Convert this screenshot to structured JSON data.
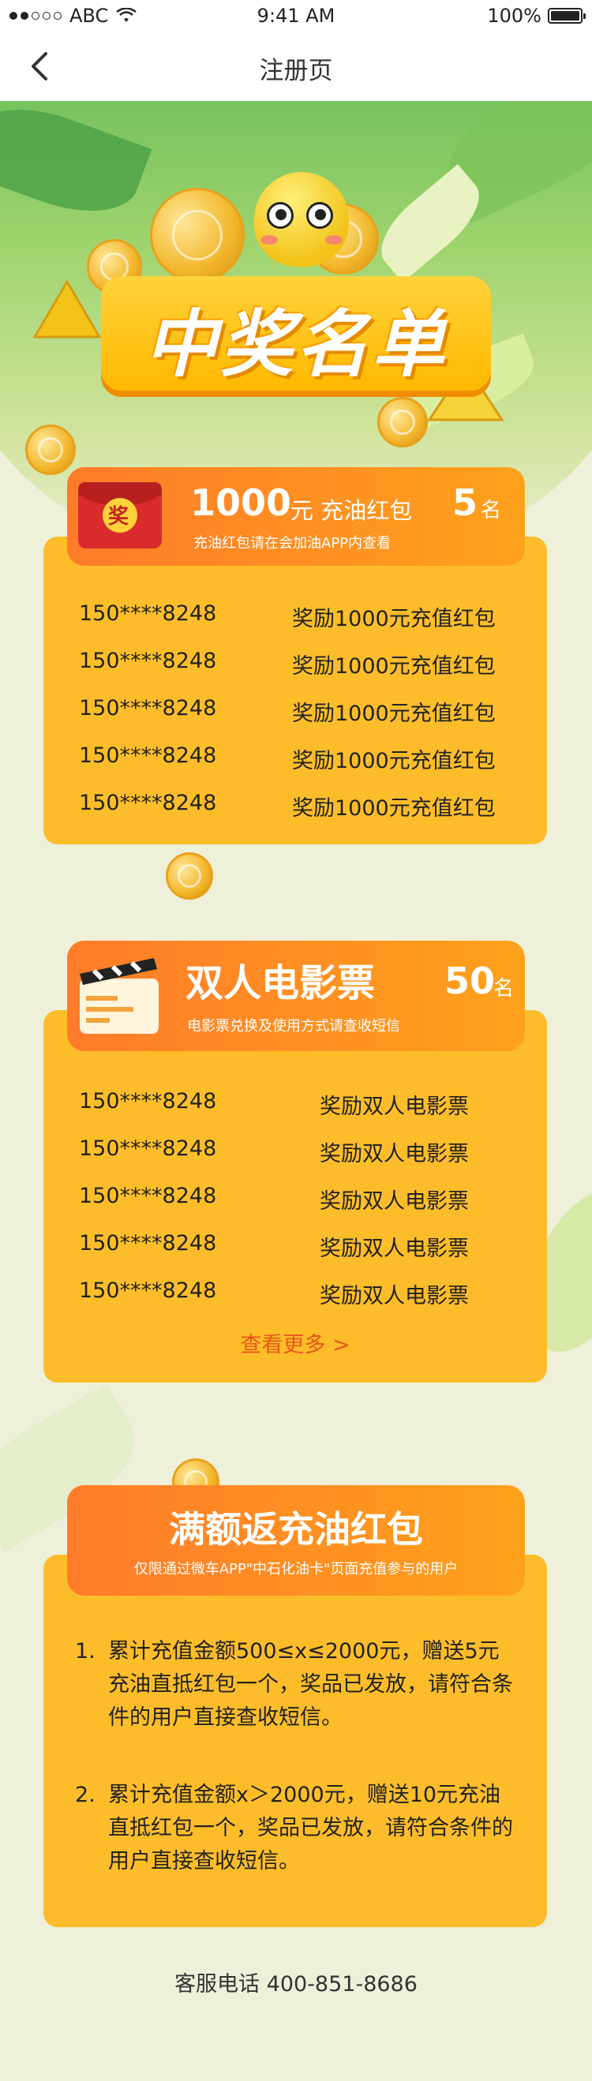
{
  "status_bar": {
    "carrier": "ABC",
    "time": "9:41 AM",
    "battery": "100%"
  },
  "nav": {
    "title": "注册页"
  },
  "hero": {
    "banner_text": "中奖名单"
  },
  "prizes": [
    {
      "name_number": "1000",
      "name_suffix": "元 充油红包",
      "subtitle": "充油红包请在会加油APP内查看",
      "count": "5",
      "count_unit": "名",
      "badge_text": "奖",
      "winners": [
        {
          "phone": "150****8248",
          "reward": "奖励1000元充值红包"
        },
        {
          "phone": "150****8248",
          "reward": "奖励1000元充值红包"
        },
        {
          "phone": "150****8248",
          "reward": "奖励1000元充值红包"
        },
        {
          "phone": "150****8248",
          "reward": "奖励1000元充值红包"
        },
        {
          "phone": "150****8248",
          "reward": "奖励1000元充值红包"
        }
      ]
    },
    {
      "name": "双人电影票",
      "subtitle": "电影票兑换及使用方式请查收短信",
      "count": "50",
      "count_unit": "名",
      "winners": [
        {
          "phone": "150****8248",
          "reward": "奖励双人电影票"
        },
        {
          "phone": "150****8248",
          "reward": "奖励双人电影票"
        },
        {
          "phone": "150****8248",
          "reward": "奖励双人电影票"
        },
        {
          "phone": "150****8248",
          "reward": "奖励双人电影票"
        },
        {
          "phone": "150****8248",
          "reward": "奖励双人电影票"
        }
      ],
      "more_label": "查看更多 >"
    }
  ],
  "rules": {
    "title": "满额返充油红包",
    "subtitle": "仅限通过微车APP\"中石化油卡\"页面充值参与的用户",
    "items": [
      {
        "num": "1.",
        "text": "累计充值金额500≤x≤2000元，赠送5元充油直抵红包一个，奖品已发放，请符合条件的用户直接查收短信。"
      },
      {
        "num": "2.",
        "text": "累计充值金额x＞2000元，赠送10元充油直抵红包一个，奖品已发放，请符合条件的用户直接查收短信。"
      }
    ]
  },
  "footer": {
    "hotline": "客服电话 400-851-8686"
  },
  "colors": {
    "card": "#fdbd2a",
    "header_gradient_start": "#ff7b2a",
    "header_gradient_end": "#ffa21b",
    "link": "#e8561b",
    "page_bg": "#eef0da"
  }
}
